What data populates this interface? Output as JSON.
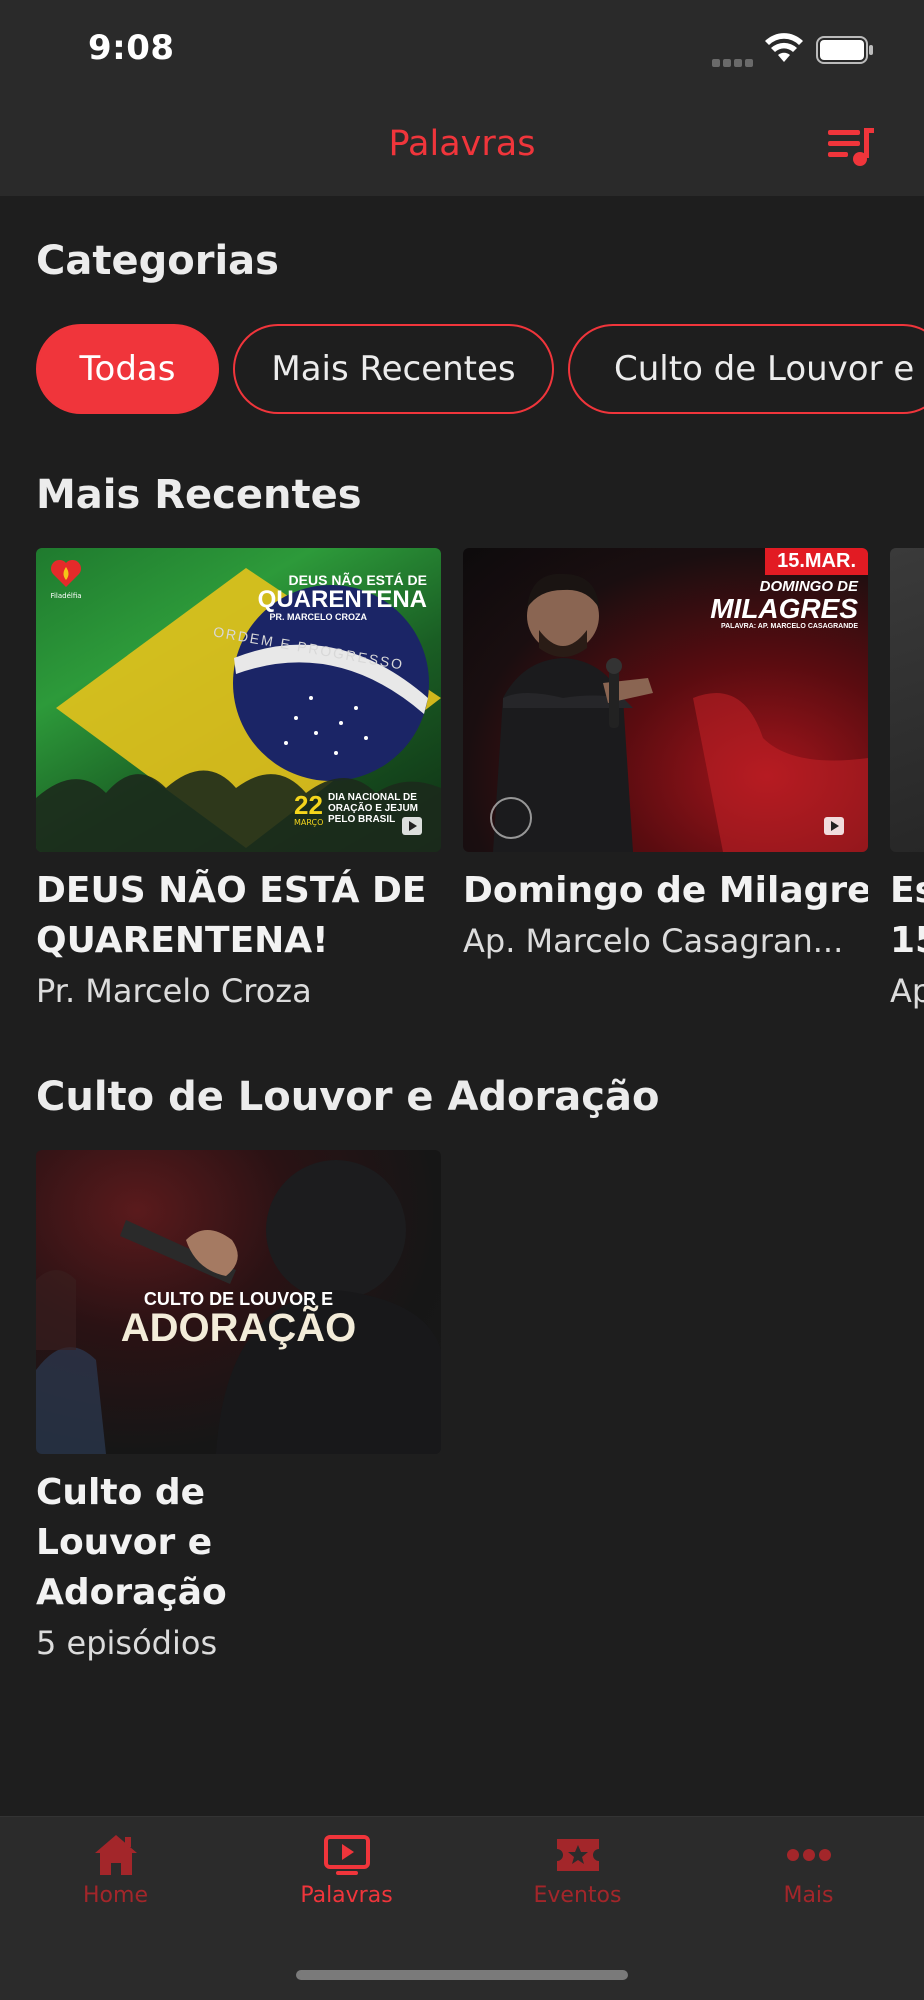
{
  "status_bar": {
    "time": "9:08"
  },
  "header": {
    "title": "Palavras",
    "queue_icon": "playlist-music-icon"
  },
  "categories": {
    "title": "Categorias",
    "pills": [
      "Todas",
      "Mais Recentes",
      "Culto de Louvor e A"
    ]
  },
  "recent": {
    "title": "Mais Recentes",
    "items": [
      {
        "title": "DEUS NÃO ESTÁ DE QUARENTENA!",
        "subtitle": "Pr. Marcelo Croza",
        "art": {
          "heading_small": "DEUS NÃO ESTÁ DE",
          "heading_big": "QUARENTENA",
          "byline": "PR. MARCELO CROZA",
          "flag_motto": "ORDEM E PROGRESSO",
          "date_day": "22",
          "date_month": "MARÇO",
          "event": "DIA NACIONAL DE ORAÇÃO E JEJUM PELO BRASIL",
          "logo_text": "Filadélfia"
        }
      },
      {
        "title": "Domingo de Milagres | Ap. Marcelo Casa...",
        "subtitle": "Ap. Marcelo Casagran...",
        "art": {
          "date_badge": "15.MAR.",
          "heading_small": "DOMINGO DE",
          "heading_big": "MILAGRES",
          "byline": "PALAVRA: AP. MARCELO CASAGRANDE"
        }
      },
      {
        "title": "Es 15",
        "subtitle": "Ap"
      }
    ]
  },
  "worship": {
    "title": "Culto de Louvor e Adoração",
    "items": [
      {
        "title": "Culto de Louvor e Adoração",
        "subtitle": "5 episódios",
        "art": {
          "heading_small": "CULTO DE LOUVOR E",
          "heading_big": "ADORAÇÃO"
        }
      }
    ]
  },
  "tabbar": {
    "items": [
      {
        "label": "Home",
        "icon": "home-icon"
      },
      {
        "label": "Palavras",
        "icon": "video-play-icon",
        "active": true
      },
      {
        "label": "Eventos",
        "icon": "ticket-icon"
      },
      {
        "label": "Mais",
        "icon": "more-dots-icon"
      }
    ]
  },
  "colors": {
    "accent": "#f0353b",
    "background": "#1e1e1e",
    "bar": "#2a2a2a",
    "tab_inactive": "#a3262a"
  }
}
